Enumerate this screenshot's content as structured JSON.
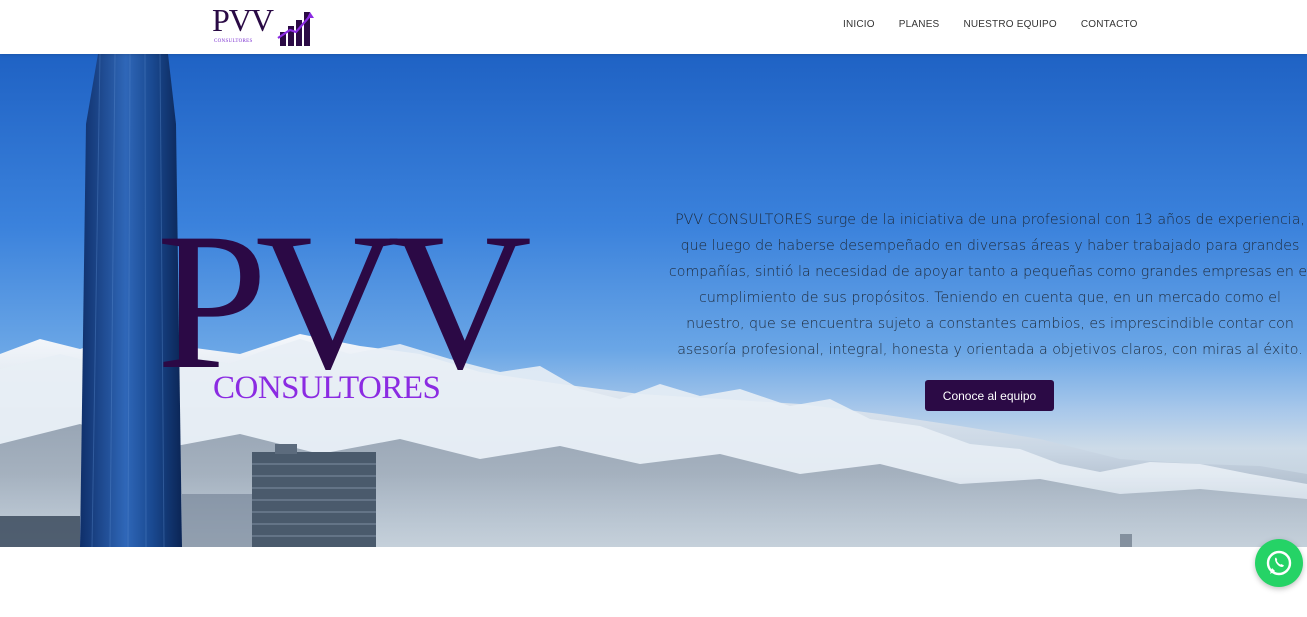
{
  "header": {
    "logo": {
      "text": "PVV",
      "subtext": "CONSULTORES"
    },
    "nav": [
      {
        "label": "INICIO"
      },
      {
        "label": "PLANES"
      },
      {
        "label": "NUESTRO EQUIPO"
      },
      {
        "label": "CONTACTO"
      }
    ]
  },
  "hero": {
    "logo_text": "PVV",
    "logo_subtext": "CONSULTORES",
    "description": "PVV CONSULTORES surge de la iniciativa de una profesional con 13 años de experiencia, que luego de haberse desempeñado en diversas áreas y haber trabajado para grandes compañías, sintió la necesidad de apoyar tanto a pequeñas como grandes empresas en el cumplimiento de sus propósitos. Teniendo en cuenta que, en un mercado como el nuestro, que se encuentra sujeto a constantes cambios, es imprescindible contar con asesoría profesional, integral, honesta y orientada a objetivos claros, con miras al éxito.",
    "button_label": "Conoce al equipo"
  },
  "floating": {
    "icon": "whatsapp-icon"
  },
  "colors": {
    "brand_dark": "#2b0a45",
    "brand_purple": "#8b2be2",
    "whatsapp_green": "#25d366"
  }
}
